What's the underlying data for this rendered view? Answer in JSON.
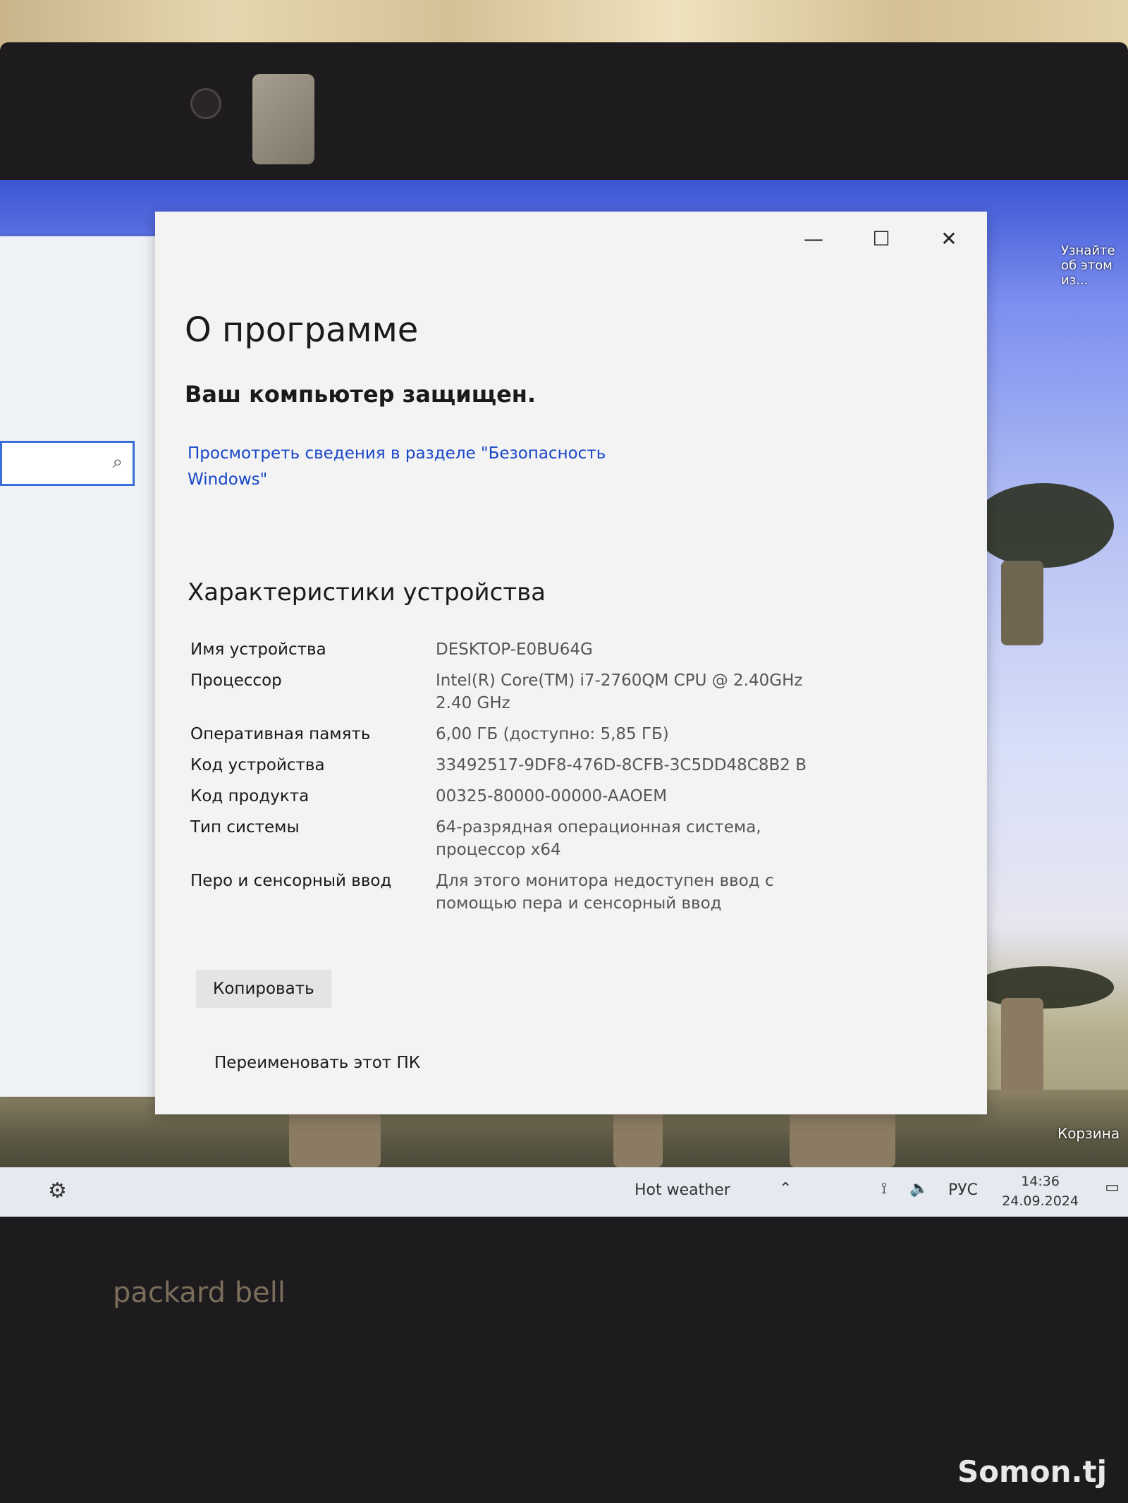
{
  "window": {
    "title": "О программе",
    "protection_status": "Ваш компьютер защищен.",
    "security_link": "Просмотреть сведения в разделе \"Безопасность Windows\"",
    "section_title": "Характеристики устройства",
    "specs": [
      {
        "key": "Имя устройства",
        "value": "DESKTOP-E0BU64G"
      },
      {
        "key": "Процессор",
        "value": "Intel(R) Core(TM) i7-2760QM CPU @ 2.40GHz   2.40 GHz"
      },
      {
        "key": "Оперативная память",
        "value": "6,00 ГБ (доступно: 5,85 ГБ)"
      },
      {
        "key": "Код устройства",
        "value": "33492517-9DF8-476D-8CFB-3C5DD48C8B2 B"
      },
      {
        "key": "Код продукта",
        "value": "00325-80000-00000-AAOEM"
      },
      {
        "key": "Тип системы",
        "value": "64-разрядная операционная система, процессор x64"
      },
      {
        "key": "Перо и сенсорный ввод",
        "value": "Для этого монитора недоступен ввод с помощью пера и сенсорный ввод"
      }
    ],
    "copy_button": "Копировать",
    "rename_button": "Переименовать этот ПК",
    "controls": {
      "minimize": "—",
      "maximize": "☐",
      "close": "✕"
    }
  },
  "desktop": {
    "top_right_label": "Узнайте об этом из...",
    "recycle_label": "Корзина"
  },
  "taskbar": {
    "weather": "Hot weather",
    "language": "РУС",
    "time": "14:36",
    "date": "24.09.2024"
  },
  "laptop_brand": "packard bell",
  "watermark": "Somon.tj",
  "colors": {
    "accent": "#3a6fd8",
    "link": "#1846c8"
  }
}
